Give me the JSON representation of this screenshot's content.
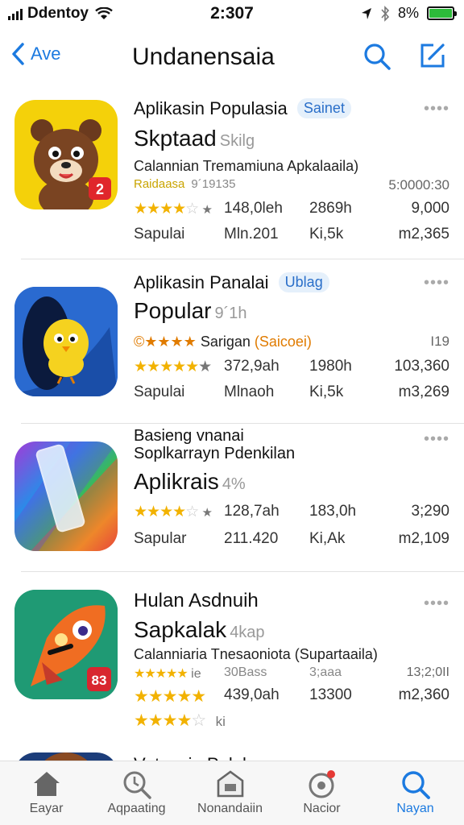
{
  "status": {
    "carrier": "Ddentoy",
    "time": "2:307",
    "battery": "8%"
  },
  "nav": {
    "back_label": "Ave",
    "title": "Undanensaia"
  },
  "apps": [
    {
      "title": "Aplikasin Populasia",
      "badge": "Sainet",
      "name": "Skptaad",
      "name_suffix": "Skilg",
      "desc": "Calannian Tremamiuna Apkalaaila)",
      "meta_left": "Raidaasa",
      "meta_mid": "9´19135",
      "meta_right": "5:0000:30",
      "rating_count": "148,0leh",
      "size": "2869h",
      "stat_right": "9,000",
      "cat": "Sapulai",
      "min": "Mln.201",
      "k": "Ki,5k",
      "price": "m2,365",
      "stars": "★★★★",
      "stars_empty": "☆",
      "after": "★"
    },
    {
      "title": "Aplikasin Panalai",
      "badge": "Ublag",
      "name": "Popular",
      "name_suffix": "9´1h",
      "desc_orange": "©★★★★",
      "desc": "Sarigan",
      "desc_orange2": "(Saicoei)",
      "meta_right": "I19",
      "rating_count": "372,9ah",
      "size": "1980h",
      "stat_right": "103,360",
      "cat": "Sapulai",
      "min": "Mlnaoh",
      "k": "Ki,5k",
      "price": "m3,269",
      "stars": "★★★★★",
      "stars_empty": "",
      "after": "★"
    },
    {
      "title": "Basieng vnanai",
      "title2": "Soplkarrayn Pdenkilan",
      "name": "Aplikrais",
      "name_suffix": "4%",
      "rating_count": "128,7ah",
      "size": "183,0h",
      "stat_right": "3;290",
      "cat": "Sapular",
      "min": "211.420",
      "k": "Ki,Ak",
      "price": "m2,109",
      "stars": "★★★★",
      "stars_empty": "☆",
      "after": "★"
    },
    {
      "title": "Hulan Asdnuih",
      "name": "Sapkalak",
      "name_suffix": "4kap",
      "desc": "Calanniaria Tnesaoniota (Supartaaila)",
      "meta_stars": "★★★★★",
      "meta_left": "ie",
      "meta_mid": "30Bass",
      "meta_mid2": "3;aaa",
      "meta_right": "13;2;0II",
      "rating_count": "439,0ah",
      "size": "13300",
      "price": "m2,360",
      "stars": "★★★★★",
      "stars3": "★★★★",
      "stars3_empty": "☆",
      "stars3_after": "ki"
    },
    {
      "title": "Vutnasin Palala"
    }
  ],
  "more_dots": "••••",
  "tabs": [
    {
      "label": "Eayar",
      "icon": "home-icon"
    },
    {
      "label": "Aqpaating",
      "icon": "magnifier-icon"
    },
    {
      "label": "Nonandaiin",
      "icon": "inbox-icon"
    },
    {
      "label": "Nacior",
      "icon": "notification-icon"
    },
    {
      "label": "Nayan",
      "icon": "search-icon"
    }
  ],
  "colors": {
    "accent": "#1c7ae0",
    "star": "#f2b200",
    "battery": "#2dbb3a"
  }
}
